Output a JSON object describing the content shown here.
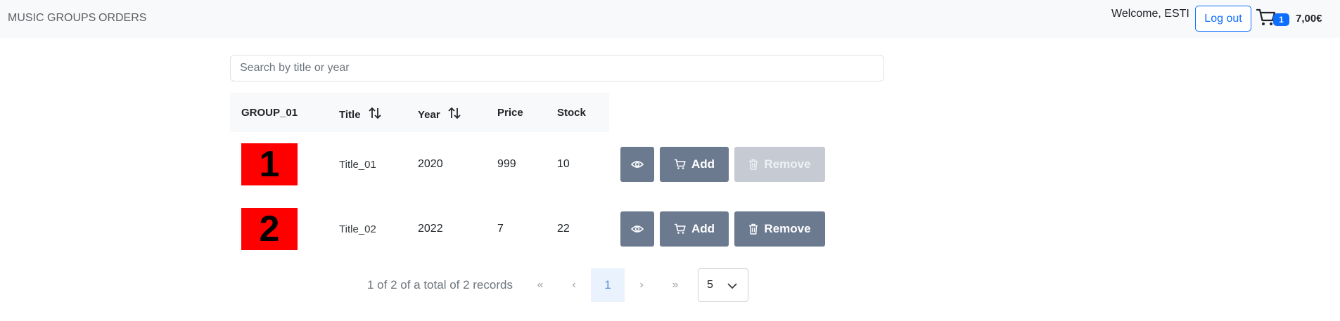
{
  "nav": {
    "links": [
      "MUSIC GROUPS",
      "ORDERS"
    ],
    "welcome": "Welcome, ESTI",
    "logout_label": "Log out",
    "cart_count": "1",
    "cart_total": "7,00€",
    "cart_icon": "cart-icon"
  },
  "search": {
    "placeholder": "Search by title or year",
    "value": ""
  },
  "table": {
    "headers": [
      "GROUP_01",
      "Title",
      "Year",
      "Price",
      "Stock"
    ],
    "sort_icon": "sort-arrows-icon",
    "rows": [
      {
        "thumb": "1",
        "title": "Title_01",
        "year": "2020",
        "price": "999",
        "stock": "10",
        "remove_enabled": false
      },
      {
        "thumb": "2",
        "title": "Title_02",
        "year": "2022",
        "price": "7",
        "stock": "22",
        "remove_enabled": true
      }
    ],
    "actions": {
      "view_icon": "eye-icon",
      "add_label": "Add",
      "add_icon": "cart-icon",
      "remove_label": "Remove",
      "remove_icon": "trash-icon"
    }
  },
  "pagination": {
    "summary": "1 of 2 of a total of 2 records",
    "first": "«",
    "prev": "‹",
    "current": "1",
    "next": "›",
    "last": "»",
    "page_size": "5"
  },
  "colors": {
    "primary": "#0d6efd",
    "button": "#6c7a90",
    "button_disabled": "#c5cad3",
    "thumb": "#ff0000",
    "navbar": "#f8f9fa"
  }
}
